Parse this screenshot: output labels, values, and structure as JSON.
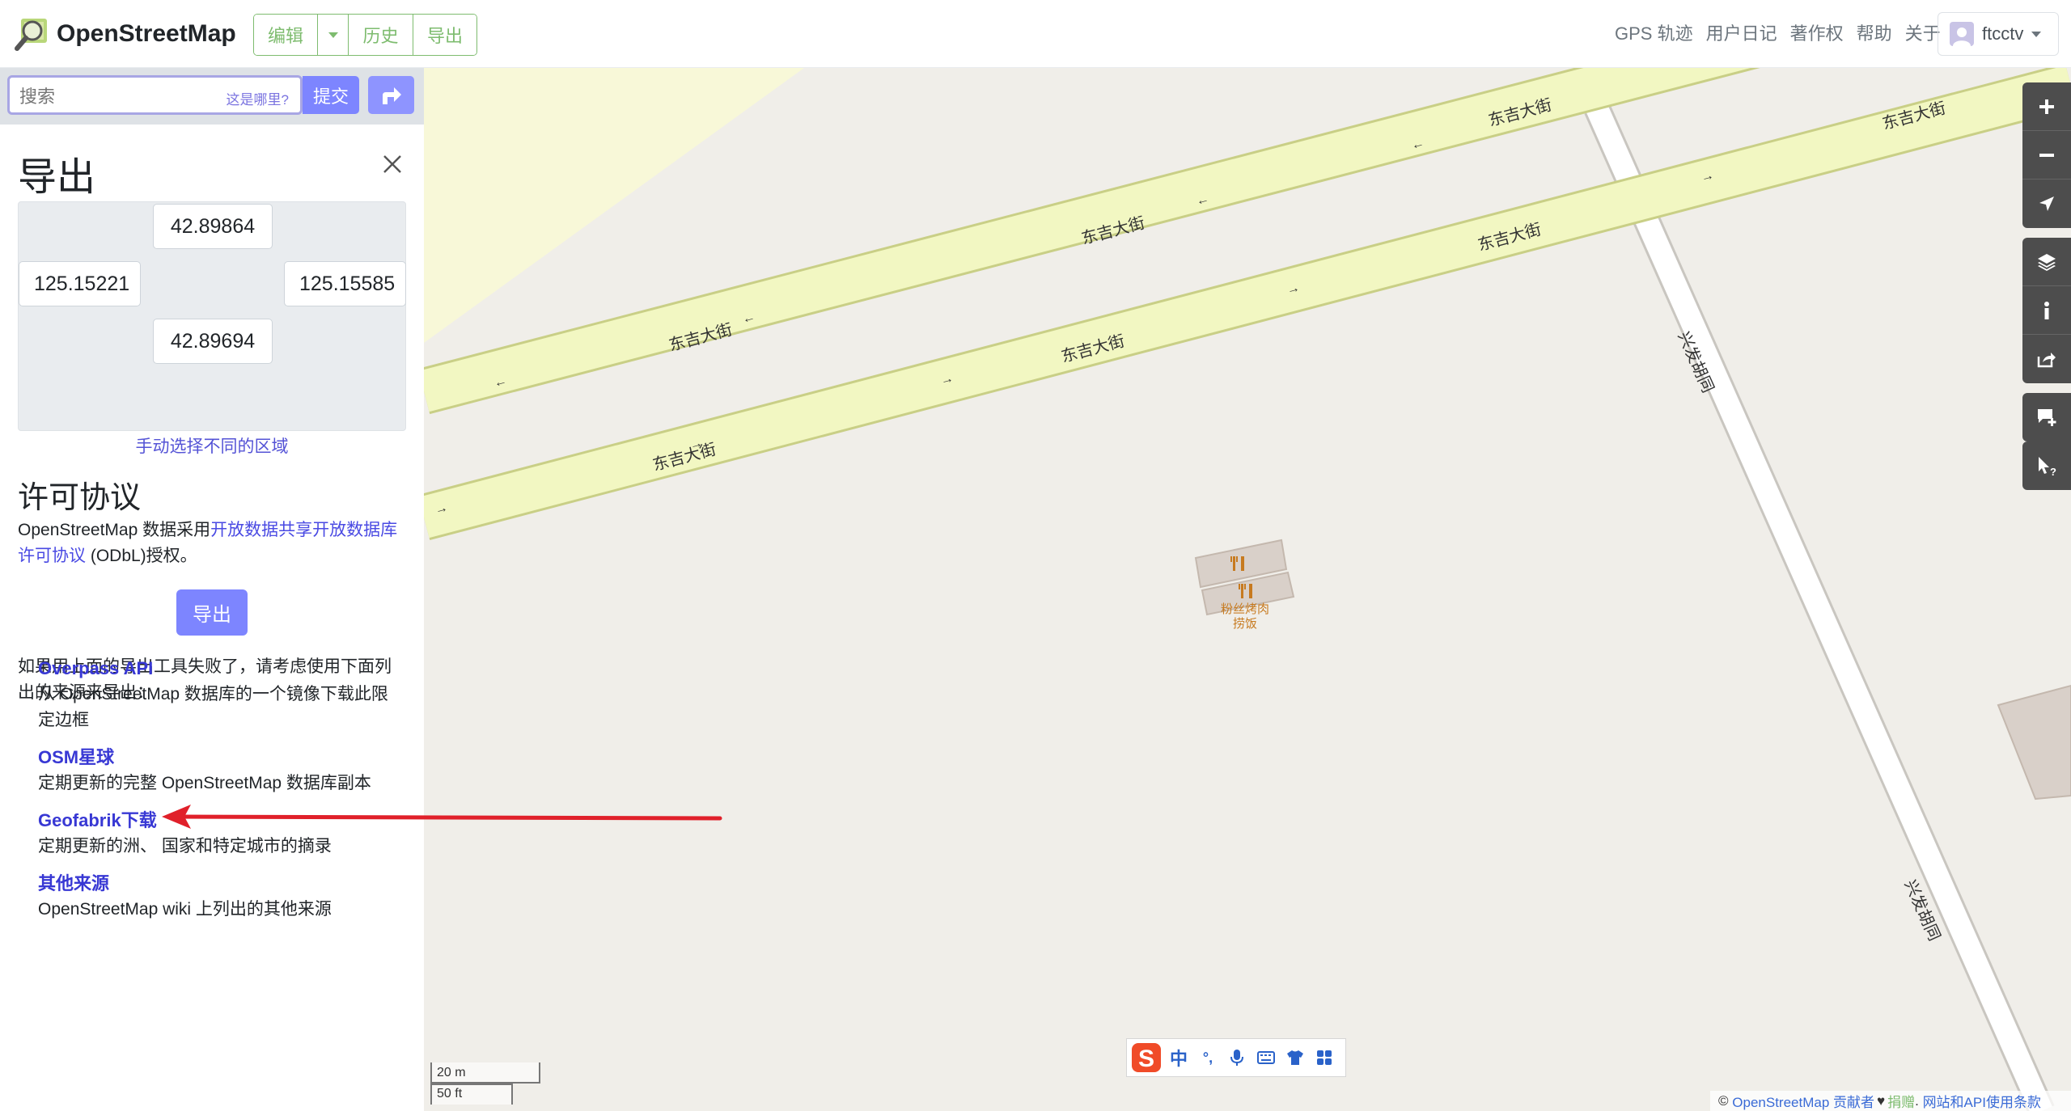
{
  "header": {
    "logo_text": "OpenStreetMap",
    "edit_label": "编辑",
    "history_label": "历史",
    "export_label": "导出",
    "nav": [
      "GPS 轨迹",
      "用户日记",
      "著作权",
      "帮助",
      "关于"
    ],
    "username": "ftcctv",
    "accent_color": "#7ebc6f"
  },
  "search": {
    "placeholder": "搜索",
    "where_label": "这是哪里?",
    "submit_label": "提交"
  },
  "export_panel": {
    "title": "导出",
    "north": "42.89864",
    "west": "125.15221",
    "east": "125.15585",
    "south": "42.89694",
    "manual_select": "手动选择不同的区域",
    "license_title": "许可协议",
    "license_text_prefix": "OpenStreetMap 数据采用",
    "license_link": "开放数据共享开放数据库许可协议",
    "license_text_suffix": " (ODbL)授权。",
    "export_button": "导出",
    "fail_note": "如果用上面的导出工具失败了，请考虑使用下面列出的来源来导出：",
    "sources": [
      {
        "title": "Overpass API",
        "desc": "从 OpenStreetMap 数据库的一个镜像下载此限定边框"
      },
      {
        "title": "OSM星球",
        "desc": "定期更新的完整 OpenStreetMap 数据库副本"
      },
      {
        "title": "Geofabrik下载",
        "desc": "定期更新的洲、 国家和特定城市的摘录"
      },
      {
        "title": "其他来源",
        "desc": "OpenStreetMap wiki 上列出的其他来源"
      }
    ]
  },
  "map": {
    "street_main": "东吉大街",
    "street_side": "兴发胡同",
    "poi_label_1": "粉丝烤肉",
    "poi_label_2": "捞饭",
    "scale_metric": "20 m",
    "scale_imperial": "50 ft",
    "attrib_copyright": "©",
    "attrib_contrib": "OpenStreetMap 贡献者",
    "attrib_heart": "♥",
    "attrib_donate": "捐赠",
    "attrib_terms": "网站和API使用条款",
    "controls": [
      "zoom-in",
      "zoom-out",
      "locate",
      "layers",
      "info",
      "share",
      "note",
      "query"
    ]
  },
  "ime": {
    "lang": "中",
    "punct": "°,"
  }
}
